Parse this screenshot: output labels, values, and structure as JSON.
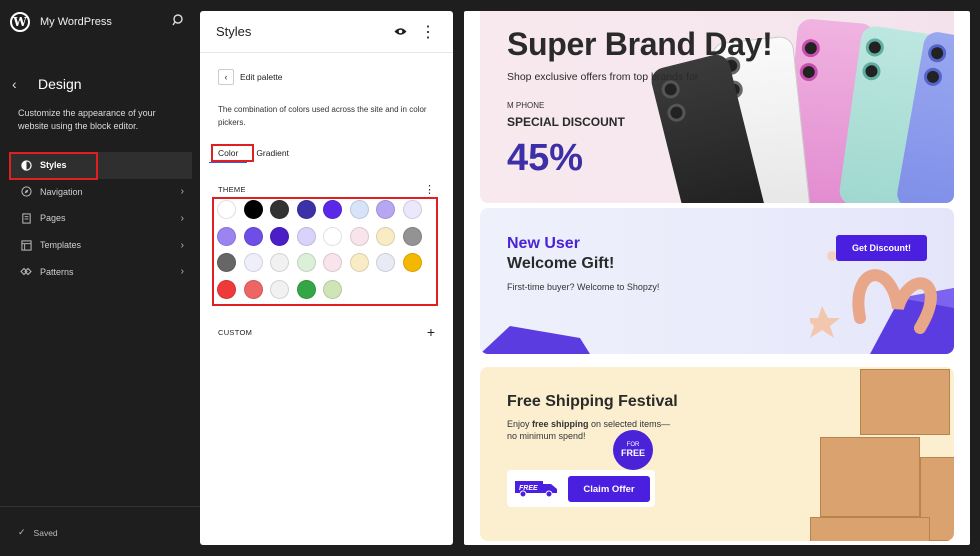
{
  "sidebar": {
    "site_title": "My WordPress",
    "section_title": "Design",
    "description": "Customize the appearance of your website using the block editor.",
    "items": [
      {
        "label": "Styles",
        "icon": "half-circle-icon",
        "active": true
      },
      {
        "label": "Navigation",
        "icon": "compass-icon"
      },
      {
        "label": "Pages",
        "icon": "page-icon"
      },
      {
        "label": "Templates",
        "icon": "layout-icon"
      },
      {
        "label": "Patterns",
        "icon": "symbol-icon"
      }
    ],
    "saved_label": "Saved"
  },
  "panel": {
    "title": "Styles",
    "edit_title": "Edit palette",
    "description": "The combination of colors used across the site and in color pickers.",
    "tabs": [
      "Color",
      "Gradient"
    ],
    "active_tab": "Color",
    "theme_label": "THEME",
    "custom_label": "CUSTOM",
    "theme_colors": [
      "#ffffff",
      "#000000",
      "#333333",
      "#3c31a6",
      "#5b28e8",
      "#d7e3f8",
      "#b7a6f1",
      "#ece8fb",
      "#9b83f2",
      "#6f4ee8",
      "#4a1fc7",
      "#d9d2fb",
      "#ffffff",
      "#f8e4ea",
      "#f9ecc5",
      "#939393",
      "#666666",
      "#efeffb",
      "#f1f1f1",
      "#dcefd8",
      "#f8e4ea",
      "#f9ecc5",
      "#e8ebf5",
      "#f5b800",
      "#ee3a3a",
      "#ee6565",
      "#f1f1f1",
      "#35a645",
      "#cfe5b6"
    ]
  },
  "preview": {
    "banner1": {
      "title": "Super Brand Day!",
      "subtitle": "Shop exclusive offers from top brands for",
      "brand": "M PHONE",
      "special": "SPECIAL DISCOUNT",
      "percent": "45%"
    },
    "banner2": {
      "title_line1": "New User",
      "title_line2": "Welcome Gift!",
      "subtitle": "First-time buyer? Welcome to Shopzy!",
      "button": "Get Discount!"
    },
    "banner3": {
      "title": "Free Shipping Festival",
      "line1_prefix": "Enjoy ",
      "line1_bold": "free shipping",
      "line1_suffix": " on selected items—",
      "line2": "no minimum spend!",
      "badge_top": "FOR",
      "badge_bottom": "FREE",
      "truck_label": "FREE",
      "button": "Claim Offer"
    }
  },
  "colors": {
    "accent": "#4a1fe0",
    "highlight": "#e02020",
    "tab_underline": "#3858e9"
  }
}
